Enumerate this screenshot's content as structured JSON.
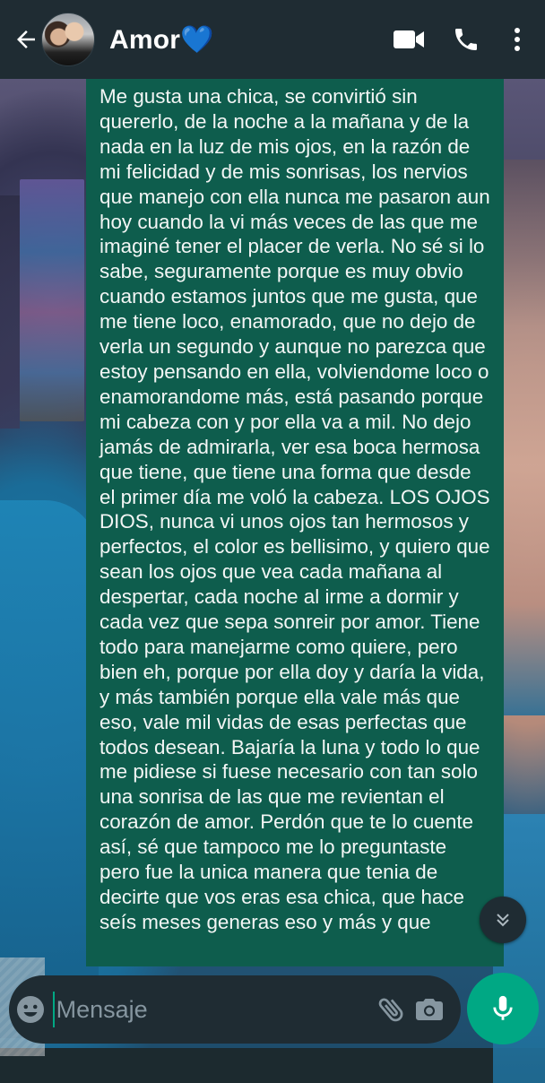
{
  "header": {
    "contact_name": "Amor💙",
    "icons": {
      "back": "arrow-left-icon",
      "video": "video-camera-icon",
      "call": "phone-icon",
      "menu": "more-vertical-icon"
    }
  },
  "message": {
    "text": "Me gusta una chica, se convirtió sin quererlo, de la noche a la mañana y de la nada en la luz de mis ojos, en la razón de mi felicidad y de mis sonrisas, los nervios que manejo con ella nunca me pasaron aun hoy cuando la vi más veces de las que me imaginé tener el placer de verla. No sé si lo sabe, seguramente porque es muy obvio cuando estamos juntos que me gusta, que me tiene loco, enamorado, que no dejo de verla un segundo y aunque no parezca que estoy pensando en ella, volviendome loco o enamorandome más, está pasando porque mi cabeza con y por ella va a mil. No dejo jamás de admirarla, ver esa boca hermosa que tiene, que tiene una forma que desde el primer día me voló la cabeza. LOS OJOS DIOS, nunca vi unos ojos tan hermosos y perfectos, el color es bellisimo, y quiero que sean los ojos que vea cada mañana al despertar, cada noche al irme a dormir y cada vez que sepa sonreir por amor. Tiene todo para manejarme como quiere, pero bien eh, porque por ella doy y daría la vida, y más también porque ella vale más que eso, vale mil vidas de esas perfectas que todos desean. Bajaría la luna y todo lo que me pidiese si fuese necesario con tan solo una sonrisa de las que me revientan el corazón de amor. Perdón que te lo cuente así, sé que tampoco me lo preguntaste pero fue la unica manera que tenia de decirte que vos eras esa chica, que hace seís meses generas eso y más y que"
  },
  "composer": {
    "placeholder": "Mensaje",
    "value": "",
    "icons": {
      "emoji": "emoji-icon",
      "attach": "paperclip-icon",
      "camera": "camera-icon",
      "mic": "microphone-icon",
      "scroll": "double-chevron-down-icon"
    }
  },
  "colors": {
    "header_bg": "#1f2c33",
    "bubble_bg": "#0e5d4d",
    "accent": "#00a884",
    "icon": "#ffffff",
    "muted_icon": "#8696a0"
  }
}
